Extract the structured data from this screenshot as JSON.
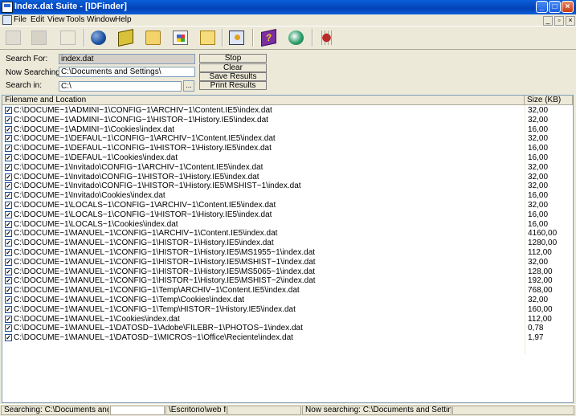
{
  "window": {
    "title": "Index.dat Suite - [IDFinder]"
  },
  "menu": [
    "File",
    "Edit",
    "View",
    "Tools",
    "Window",
    "Help"
  ],
  "toolbar_icons": [
    "blank-icon",
    "panel-icon",
    "arrow-icon",
    "globe-icon",
    "book-icon",
    "folder-open-icon",
    "windows-icon",
    "folder-icon",
    "control-panel-icon",
    "help-book-icon",
    "network-icon",
    "bug-icon"
  ],
  "search": {
    "for_label": "Search For:",
    "for_value": "index.dat",
    "now_label": "Now Searching:",
    "now_value": "C:\\Documents and Settings\\",
    "in_label": "Search in:",
    "in_value": "C:\\",
    "browse_label": "..."
  },
  "buttons": {
    "stop": "Stop",
    "clear": "Clear",
    "save": "Save Results",
    "print": "Print Results"
  },
  "columns": {
    "name": "Filename and Location",
    "size": "Size (KB)"
  },
  "rows": [
    {
      "name": "C:\\DOCUME~1\\ADMINI~1\\CONFIG~1\\ARCHIV~1\\Content.IE5\\index.dat",
      "size": "32,00"
    },
    {
      "name": "C:\\DOCUME~1\\ADMINI~1\\CONFIG~1\\HISTOR~1\\History.IE5\\index.dat",
      "size": "32,00"
    },
    {
      "name": "C:\\DOCUME~1\\ADMINI~1\\Cookies\\index.dat",
      "size": "16,00"
    },
    {
      "name": "C:\\DOCUME~1\\DEFAUL~1\\CONFIG~1\\ARCHIV~1\\Content.IE5\\index.dat",
      "size": "32,00"
    },
    {
      "name": "C:\\DOCUME~1\\DEFAUL~1\\CONFIG~1\\HISTOR~1\\History.IE5\\index.dat",
      "size": "16,00"
    },
    {
      "name": "C:\\DOCUME~1\\DEFAUL~1\\Cookies\\index.dat",
      "size": "16,00"
    },
    {
      "name": "C:\\DOCUME~1\\Invitado\\CONFIG~1\\ARCHIV~1\\Content.IE5\\index.dat",
      "size": "32,00"
    },
    {
      "name": "C:\\DOCUME~1\\Invitado\\CONFIG~1\\HISTOR~1\\History.IE5\\index.dat",
      "size": "32,00"
    },
    {
      "name": "C:\\DOCUME~1\\Invitado\\CONFIG~1\\HISTOR~1\\History.IE5\\MSHIST~1\\index.dat",
      "size": "32,00"
    },
    {
      "name": "C:\\DOCUME~1\\Invitado\\Cookies\\index.dat",
      "size": "16,00"
    },
    {
      "name": "C:\\DOCUME~1\\LOCALS~1\\CONFIG~1\\ARCHIV~1\\Content.IE5\\index.dat",
      "size": "32,00"
    },
    {
      "name": "C:\\DOCUME~1\\LOCALS~1\\CONFIG~1\\HISTOR~1\\History.IE5\\index.dat",
      "size": "16,00"
    },
    {
      "name": "C:\\DOCUME~1\\LOCALS~1\\Cookies\\index.dat",
      "size": "16,00"
    },
    {
      "name": "C:\\DOCUME~1\\MANUEL~1\\CONFIG~1\\ARCHIV~1\\Content.IE5\\index.dat",
      "size": "4160,00"
    },
    {
      "name": "C:\\DOCUME~1\\MANUEL~1\\CONFIG~1\\HISTOR~1\\History.IE5\\index.dat",
      "size": "1280,00"
    },
    {
      "name": "C:\\DOCUME~1\\MANUEL~1\\CONFIG~1\\HISTOR~1\\History.IE5\\MS1955~1\\index.dat",
      "size": "112,00"
    },
    {
      "name": "C:\\DOCUME~1\\MANUEL~1\\CONFIG~1\\HISTOR~1\\History.IE5\\MSHIST~1\\index.dat",
      "size": "32,00"
    },
    {
      "name": "C:\\DOCUME~1\\MANUEL~1\\CONFIG~1\\HISTOR~1\\History.IE5\\MS5065~1\\index.dat",
      "size": "128,00"
    },
    {
      "name": "C:\\DOCUME~1\\MANUEL~1\\CONFIG~1\\HISTOR~1\\History.IE5\\MSHIST~2\\index.dat",
      "size": "192,00"
    },
    {
      "name": "C:\\DOCUME~1\\MANUEL~1\\CONFIG~1\\Temp\\ARCHIV~1\\Content.IE5\\index.dat",
      "size": "768,00"
    },
    {
      "name": "C:\\DOCUME~1\\MANUEL~1\\CONFIG~1\\Temp\\Cookies\\index.dat",
      "size": "32,00"
    },
    {
      "name": "C:\\DOCUME~1\\MANUEL~1\\CONFIG~1\\Temp\\HISTOR~1\\History.IE5\\index.dat",
      "size": "160,00"
    },
    {
      "name": "C:\\DOCUME~1\\MANUEL~1\\Cookies\\index.dat",
      "size": "112,00"
    },
    {
      "name": "C:\\DOCUME~1\\MANUEL~1\\DATOSD~1\\Adobe\\FILEBR~1\\PHOTOS~1\\index.dat",
      "size": "0,78"
    },
    {
      "name": "C:\\DOCUME~1\\MANUEL~1\\DATOSD~1\\MICROS~1\\Office\\Reciente\\index.dat",
      "size": "1,97"
    }
  ],
  "status": {
    "pane1": "Searching: C:\\Documents and Settings\\",
    "pane2": "",
    "pane3": "\\Escritorio\\web flash\\",
    "pane4": "",
    "pane5": "Now searching: C:\\Documents and Settings\\MANUEL"
  }
}
